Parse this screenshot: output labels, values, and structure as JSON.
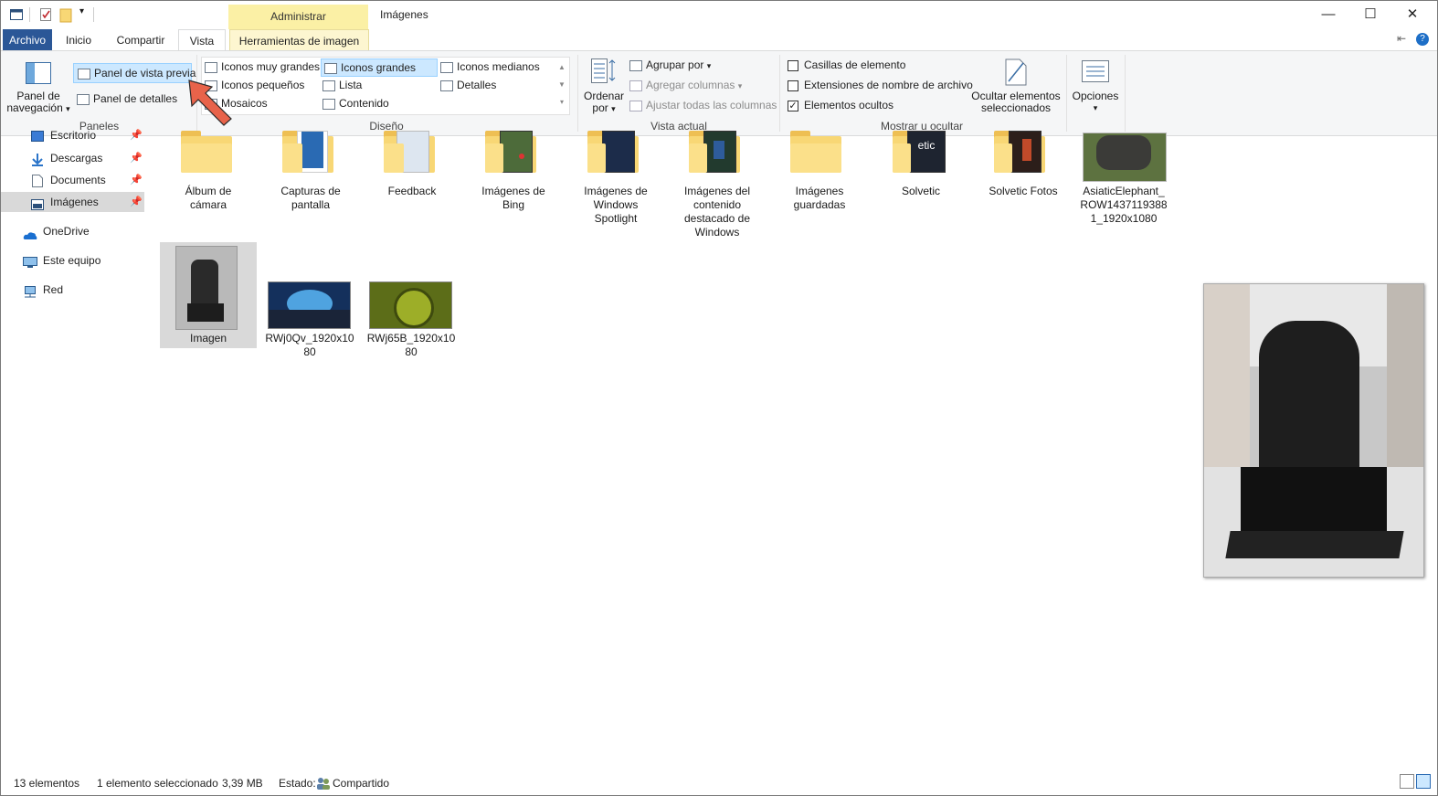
{
  "window": {
    "title": "Imágenes",
    "context_tab_group": "Administrar"
  },
  "tabs": [
    {
      "label": "Archivo"
    },
    {
      "label": "Inicio"
    },
    {
      "label": "Compartir"
    },
    {
      "label": "Vista"
    },
    {
      "label": "Herramientas de imagen"
    }
  ],
  "ribbon": {
    "panes": {
      "nav_pane_line1": "Panel de",
      "nav_pane_line2": "navegación",
      "preview_pane": "Panel de vista previa",
      "details_pane": "Panel de detalles",
      "label": "Paneles"
    },
    "layout": {
      "options": [
        "Iconos muy grandes",
        "Iconos grandes",
        "Iconos medianos",
        "Iconos pequeños",
        "Lista",
        "Detalles",
        "Mosaicos",
        "Contenido"
      ],
      "selected": "Iconos grandes",
      "label": "Diseño"
    },
    "current_view": {
      "sort_line1": "Ordenar",
      "sort_line2": "por",
      "group_by": "Agrupar por",
      "add_columns": "Agregar columnas",
      "fit_columns": "Ajustar todas las columnas",
      "label": "Vista actual"
    },
    "show_hide": {
      "item_checkboxes": {
        "label": "Casillas de elemento",
        "checked": false
      },
      "file_extensions": {
        "label": "Extensiones de nombre de archivo",
        "checked": false
      },
      "hidden_items": {
        "label": "Elementos ocultos",
        "checked": true
      },
      "hide_selected_line1": "Ocultar elementos",
      "hide_selected_line2": "seleccionados",
      "label": "Mostrar u ocultar"
    },
    "options": "Opciones"
  },
  "nav": [
    {
      "label": "Escritorio",
      "pinned": true
    },
    {
      "label": "Descargas",
      "pinned": true
    },
    {
      "label": "Documents",
      "pinned": true
    },
    {
      "label": "Imágenes",
      "pinned": true,
      "selected": true
    },
    {
      "label": "OneDrive"
    },
    {
      "label": "Este equipo"
    },
    {
      "label": "Red"
    }
  ],
  "items_row1": [
    {
      "name_l1": "Álbum de",
      "name_l2": "cámara"
    },
    {
      "name_l1": "Capturas de",
      "name_l2": "pantalla"
    },
    {
      "name_l1": "Feedback"
    },
    {
      "name_l1": "Imágenes de",
      "name_l2": "Bing"
    },
    {
      "name_l1": "Imágenes de",
      "name_l2": "Windows",
      "name_l3": "Spotlight"
    },
    {
      "name_l1": "Imágenes del",
      "name_l2": "contenido",
      "name_l3": "destacado de",
      "name_l4": "Windows"
    },
    {
      "name_l1": "Imágenes",
      "name_l2": "guardadas"
    },
    {
      "name_l1": "Solvetic"
    },
    {
      "name_l1": "Solvetic Fotos"
    },
    {
      "name_l1": "AsiaticElephant_",
      "name_l2": "ROW1437119388",
      "name_l3": "1_1920x1080"
    }
  ],
  "items_row2": [
    {
      "name_l1": "Imagen",
      "selected": true
    },
    {
      "name_l1": "RWj0Qv_1920x10",
      "name_l2": "80"
    },
    {
      "name_l1": "RWj65B_1920x10",
      "name_l2": "80"
    }
  ],
  "folder_badge_text": "etic",
  "status": {
    "count": "13 elementos",
    "selection": "1 elemento seleccionado",
    "size": "3,39 MB",
    "state_label": "Estado:",
    "state_value": "Compartido"
  },
  "colors": {
    "file_tab": "#2b5797",
    "context_tab": "#fbf0a5",
    "selection_highlight": "#cce8ff",
    "callout_arrow": "#e8634a"
  }
}
